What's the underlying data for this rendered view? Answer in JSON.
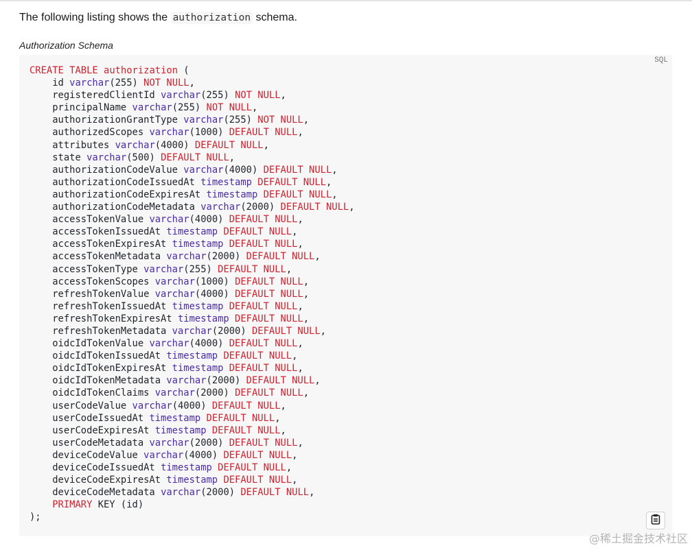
{
  "intro": {
    "before": "The following listing shows the ",
    "code": "authorization",
    "after": " schema."
  },
  "caption": "Authorization Schema",
  "code_block": {
    "language": "SQL",
    "lines": [
      [
        [
          "kw",
          "CREATE"
        ],
        [
          "t",
          " "
        ],
        [
          "kw",
          "TABLE"
        ],
        [
          "t",
          " "
        ],
        [
          "kw",
          "authorization"
        ],
        [
          "t",
          " ("
        ]
      ],
      [
        [
          "t",
          "    id "
        ],
        [
          "ty",
          "varchar"
        ],
        [
          "t",
          "(255) "
        ],
        [
          "kw",
          "NOT NULL"
        ],
        [
          "t",
          ","
        ]
      ],
      [
        [
          "t",
          "    registeredClientId "
        ],
        [
          "ty",
          "varchar"
        ],
        [
          "t",
          "(255) "
        ],
        [
          "kw",
          "NOT NULL"
        ],
        [
          "t",
          ","
        ]
      ],
      [
        [
          "t",
          "    principalName "
        ],
        [
          "ty",
          "varchar"
        ],
        [
          "t",
          "(255) "
        ],
        [
          "kw",
          "NOT NULL"
        ],
        [
          "t",
          ","
        ]
      ],
      [
        [
          "t",
          "    authorizationGrantType "
        ],
        [
          "ty",
          "varchar"
        ],
        [
          "t",
          "(255) "
        ],
        [
          "kw",
          "NOT NULL"
        ],
        [
          "t",
          ","
        ]
      ],
      [
        [
          "t",
          "    authorizedScopes "
        ],
        [
          "ty",
          "varchar"
        ],
        [
          "t",
          "(1000) "
        ],
        [
          "kw",
          "DEFAULT NULL"
        ],
        [
          "t",
          ","
        ]
      ],
      [
        [
          "t",
          "    attributes "
        ],
        [
          "ty",
          "varchar"
        ],
        [
          "t",
          "(4000) "
        ],
        [
          "kw",
          "DEFAULT NULL"
        ],
        [
          "t",
          ","
        ]
      ],
      [
        [
          "t",
          "    state "
        ],
        [
          "ty",
          "varchar"
        ],
        [
          "t",
          "(500) "
        ],
        [
          "kw",
          "DEFAULT NULL"
        ],
        [
          "t",
          ","
        ]
      ],
      [
        [
          "t",
          "    authorizationCodeValue "
        ],
        [
          "ty",
          "varchar"
        ],
        [
          "t",
          "(4000) "
        ],
        [
          "kw",
          "DEFAULT NULL"
        ],
        [
          "t",
          ","
        ]
      ],
      [
        [
          "t",
          "    authorizationCodeIssuedAt "
        ],
        [
          "ty",
          "timestamp"
        ],
        [
          "t",
          " "
        ],
        [
          "kw",
          "DEFAULT NULL"
        ],
        [
          "t",
          ","
        ]
      ],
      [
        [
          "t",
          "    authorizationCodeExpiresAt "
        ],
        [
          "ty",
          "timestamp"
        ],
        [
          "t",
          " "
        ],
        [
          "kw",
          "DEFAULT NULL"
        ],
        [
          "t",
          ","
        ]
      ],
      [
        [
          "t",
          "    authorizationCodeMetadata "
        ],
        [
          "ty",
          "varchar"
        ],
        [
          "t",
          "(2000) "
        ],
        [
          "kw",
          "DEFAULT NULL"
        ],
        [
          "t",
          ","
        ]
      ],
      [
        [
          "t",
          "    accessTokenValue "
        ],
        [
          "ty",
          "varchar"
        ],
        [
          "t",
          "(4000) "
        ],
        [
          "kw",
          "DEFAULT NULL"
        ],
        [
          "t",
          ","
        ]
      ],
      [
        [
          "t",
          "    accessTokenIssuedAt "
        ],
        [
          "ty",
          "timestamp"
        ],
        [
          "t",
          " "
        ],
        [
          "kw",
          "DEFAULT NULL"
        ],
        [
          "t",
          ","
        ]
      ],
      [
        [
          "t",
          "    accessTokenExpiresAt "
        ],
        [
          "ty",
          "timestamp"
        ],
        [
          "t",
          " "
        ],
        [
          "kw",
          "DEFAULT NULL"
        ],
        [
          "t",
          ","
        ]
      ],
      [
        [
          "t",
          "    accessTokenMetadata "
        ],
        [
          "ty",
          "varchar"
        ],
        [
          "t",
          "(2000) "
        ],
        [
          "kw",
          "DEFAULT NULL"
        ],
        [
          "t",
          ","
        ]
      ],
      [
        [
          "t",
          "    accessTokenType "
        ],
        [
          "ty",
          "varchar"
        ],
        [
          "t",
          "(255) "
        ],
        [
          "kw",
          "DEFAULT NULL"
        ],
        [
          "t",
          ","
        ]
      ],
      [
        [
          "t",
          "    accessTokenScopes "
        ],
        [
          "ty",
          "varchar"
        ],
        [
          "t",
          "(1000) "
        ],
        [
          "kw",
          "DEFAULT NULL"
        ],
        [
          "t",
          ","
        ]
      ],
      [
        [
          "t",
          "    refreshTokenValue "
        ],
        [
          "ty",
          "varchar"
        ],
        [
          "t",
          "(4000) "
        ],
        [
          "kw",
          "DEFAULT NULL"
        ],
        [
          "t",
          ","
        ]
      ],
      [
        [
          "t",
          "    refreshTokenIssuedAt "
        ],
        [
          "ty",
          "timestamp"
        ],
        [
          "t",
          " "
        ],
        [
          "kw",
          "DEFAULT NULL"
        ],
        [
          "t",
          ","
        ]
      ],
      [
        [
          "t",
          "    refreshTokenExpiresAt "
        ],
        [
          "ty",
          "timestamp"
        ],
        [
          "t",
          " "
        ],
        [
          "kw",
          "DEFAULT NULL"
        ],
        [
          "t",
          ","
        ]
      ],
      [
        [
          "t",
          "    refreshTokenMetadata "
        ],
        [
          "ty",
          "varchar"
        ],
        [
          "t",
          "(2000) "
        ],
        [
          "kw",
          "DEFAULT NULL"
        ],
        [
          "t",
          ","
        ]
      ],
      [
        [
          "t",
          "    oidcIdTokenValue "
        ],
        [
          "ty",
          "varchar"
        ],
        [
          "t",
          "(4000) "
        ],
        [
          "kw",
          "DEFAULT NULL"
        ],
        [
          "t",
          ","
        ]
      ],
      [
        [
          "t",
          "    oidcIdTokenIssuedAt "
        ],
        [
          "ty",
          "timestamp"
        ],
        [
          "t",
          " "
        ],
        [
          "kw",
          "DEFAULT NULL"
        ],
        [
          "t",
          ","
        ]
      ],
      [
        [
          "t",
          "    oidcIdTokenExpiresAt "
        ],
        [
          "ty",
          "timestamp"
        ],
        [
          "t",
          " "
        ],
        [
          "kw",
          "DEFAULT NULL"
        ],
        [
          "t",
          ","
        ]
      ],
      [
        [
          "t",
          "    oidcIdTokenMetadata "
        ],
        [
          "ty",
          "varchar"
        ],
        [
          "t",
          "(2000) "
        ],
        [
          "kw",
          "DEFAULT NULL"
        ],
        [
          "t",
          ","
        ]
      ],
      [
        [
          "t",
          "    oidcIdTokenClaims "
        ],
        [
          "ty",
          "varchar"
        ],
        [
          "t",
          "(2000) "
        ],
        [
          "kw",
          "DEFAULT NULL"
        ],
        [
          "t",
          ","
        ]
      ],
      [
        [
          "t",
          "    userCodeValue "
        ],
        [
          "ty",
          "varchar"
        ],
        [
          "t",
          "(4000) "
        ],
        [
          "kw",
          "DEFAULT NULL"
        ],
        [
          "t",
          ","
        ]
      ],
      [
        [
          "t",
          "    userCodeIssuedAt "
        ],
        [
          "ty",
          "timestamp"
        ],
        [
          "t",
          " "
        ],
        [
          "kw",
          "DEFAULT NULL"
        ],
        [
          "t",
          ","
        ]
      ],
      [
        [
          "t",
          "    userCodeExpiresAt "
        ],
        [
          "ty",
          "timestamp"
        ],
        [
          "t",
          " "
        ],
        [
          "kw",
          "DEFAULT NULL"
        ],
        [
          "t",
          ","
        ]
      ],
      [
        [
          "t",
          "    userCodeMetadata "
        ],
        [
          "ty",
          "varchar"
        ],
        [
          "t",
          "(2000) "
        ],
        [
          "kw",
          "DEFAULT NULL"
        ],
        [
          "t",
          ","
        ]
      ],
      [
        [
          "t",
          "    deviceCodeValue "
        ],
        [
          "ty",
          "varchar"
        ],
        [
          "t",
          "(4000) "
        ],
        [
          "kw",
          "DEFAULT NULL"
        ],
        [
          "t",
          ","
        ]
      ],
      [
        [
          "t",
          "    deviceCodeIssuedAt "
        ],
        [
          "ty",
          "timestamp"
        ],
        [
          "t",
          " "
        ],
        [
          "kw",
          "DEFAULT NULL"
        ],
        [
          "t",
          ","
        ]
      ],
      [
        [
          "t",
          "    deviceCodeExpiresAt "
        ],
        [
          "ty",
          "timestamp"
        ],
        [
          "t",
          " "
        ],
        [
          "kw",
          "DEFAULT NULL"
        ],
        [
          "t",
          ","
        ]
      ],
      [
        [
          "t",
          "    deviceCodeMetadata "
        ],
        [
          "ty",
          "varchar"
        ],
        [
          "t",
          "(2000) "
        ],
        [
          "kw",
          "DEFAULT NULL"
        ],
        [
          "t",
          ","
        ]
      ],
      [
        [
          "t",
          "    "
        ],
        [
          "kw",
          "PRIMARY"
        ],
        [
          "t",
          " KEY (id)"
        ]
      ],
      [
        [
          "t",
          ");"
        ]
      ]
    ],
    "copy_icon": "clipboard-icon"
  },
  "watermark": "@稀土掘金技术社区",
  "colors": {
    "keyword": "#cf222e",
    "type": "#4b2ba6",
    "code_bg": "#f7f7f8"
  }
}
